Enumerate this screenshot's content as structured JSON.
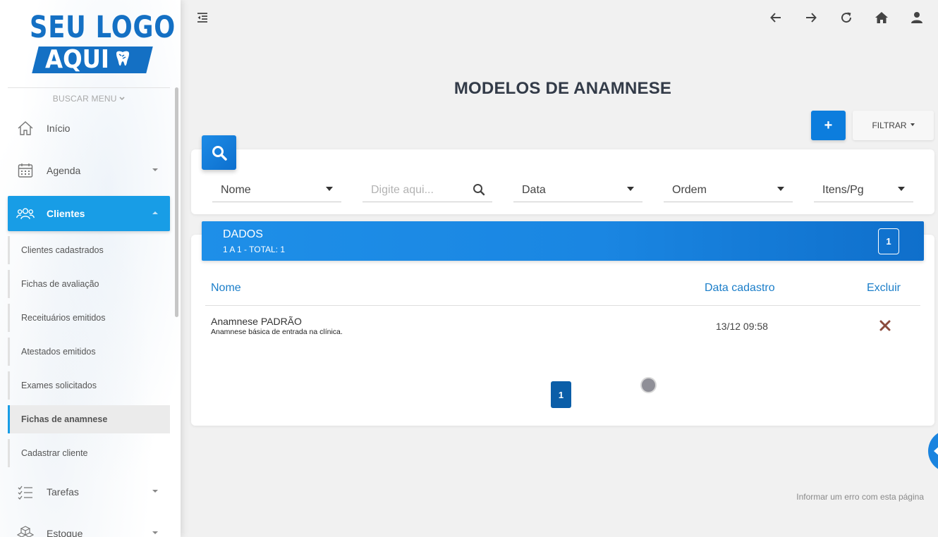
{
  "logo": {
    "top": "SEU LOGO",
    "bottom": "AQUI"
  },
  "sidebar": {
    "menu_search": "BUSCAR MENU",
    "items": [
      {
        "label": "Início",
        "icon": "home-icon"
      },
      {
        "label": "Agenda",
        "icon": "calendar-icon"
      },
      {
        "label": "Clientes",
        "icon": "users-icon"
      },
      {
        "label": "Tarefas",
        "icon": "checklist-icon"
      },
      {
        "label": "Estoque",
        "icon": "boxes-icon"
      }
    ],
    "subitems": [
      "Clientes cadastrados",
      "Fichas de avaliação",
      "Receituários emitidos",
      "Atestados emitidos",
      "Exames solicitados",
      "Fichas de anamnese",
      "Cadastrar cliente"
    ]
  },
  "topbar": {
    "icons": [
      "arrow-left-icon",
      "arrow-right-icon",
      "refresh-icon",
      "home-icon",
      "user-icon"
    ]
  },
  "page": {
    "title": "MODELOS DE ANAMNESE",
    "add_label": "+",
    "filter_label": "FILTRAR"
  },
  "filters": {
    "name_select": "Nome",
    "search_placeholder": "Digite aqui...",
    "date_select": "Data",
    "order_select": "Ordem",
    "items_select": "Itens/Pg"
  },
  "data": {
    "title": "DADOS",
    "subtitle": "1 A 1 - TOTAL: 1",
    "page": "1",
    "columns": {
      "name": "Nome",
      "date": "Data cadastro",
      "delete": "Excluir"
    },
    "rows": [
      {
        "name": "Anamnese PADRÃO",
        "description": "Anamnese básica de entrada na clínica.",
        "date": "13/12 09:58"
      }
    ],
    "pager": "1"
  },
  "footer": {
    "report": "Informar um erro com esta página"
  },
  "colors": {
    "accent": "#189de6",
    "primary": "#0c7ddd",
    "delete": "#8b4b3c"
  }
}
